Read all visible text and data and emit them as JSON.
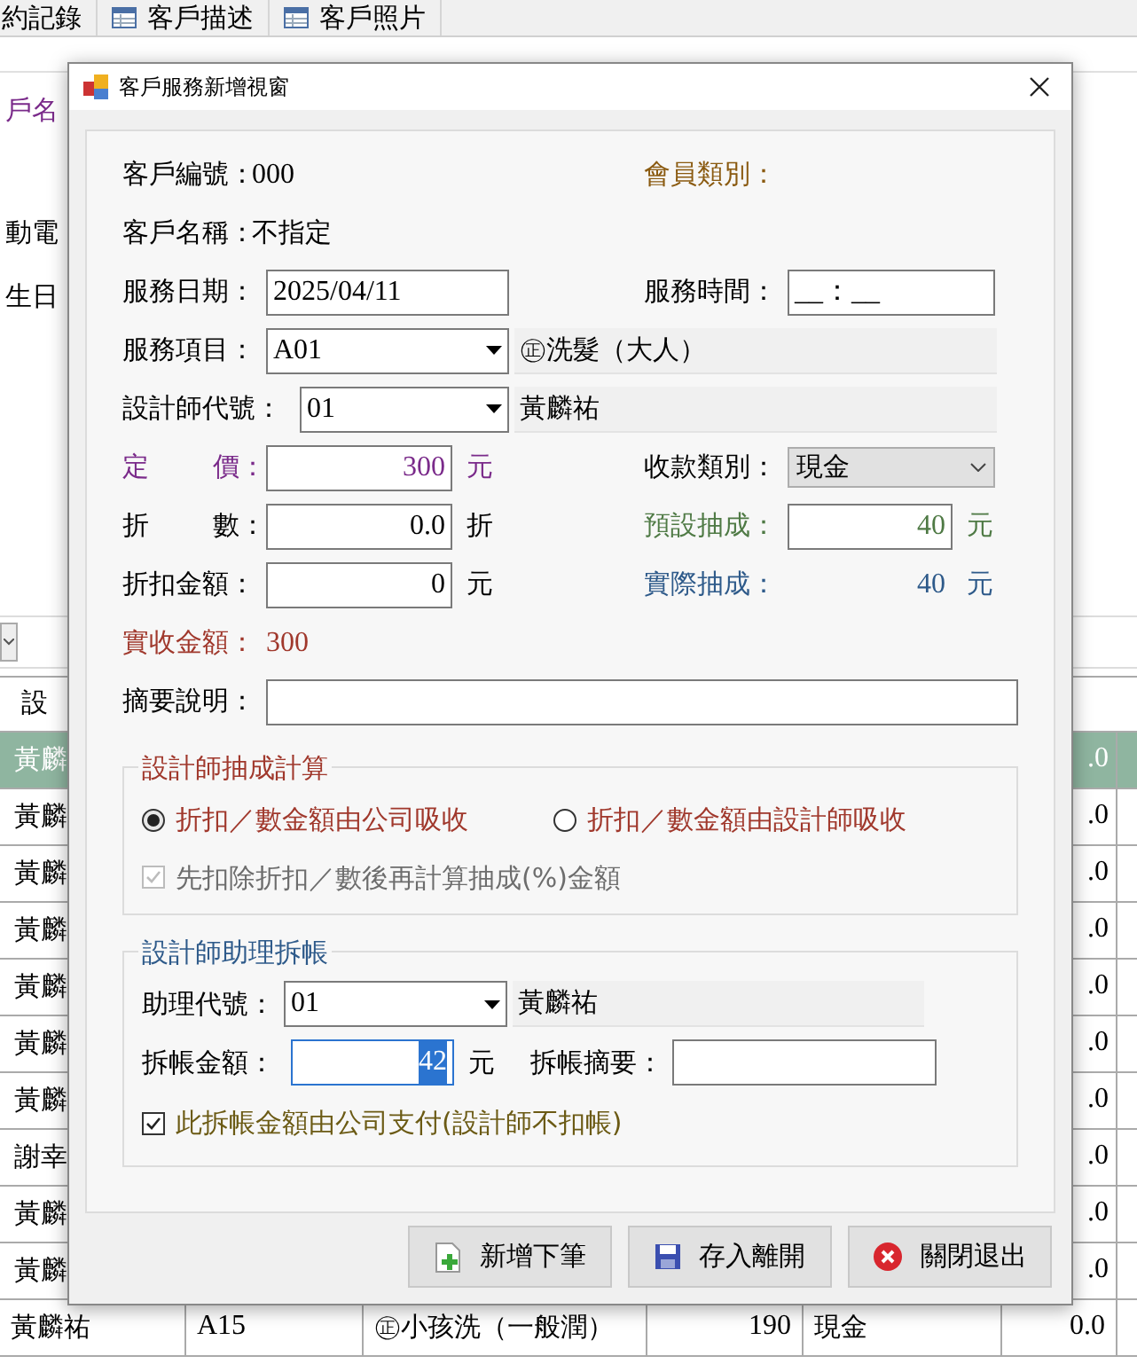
{
  "background": {
    "tabs": [
      {
        "label": "約記錄",
        "icon": false
      },
      {
        "label": "客戶描述",
        "icon": true
      },
      {
        "label": "客戶照片",
        "icon": true
      }
    ],
    "side_labels": [
      "戶名",
      "動電",
      "生日"
    ],
    "table": {
      "header": [
        "設"
      ],
      "rows": [
        {
          "selected": true,
          "cells": [
            "黃麟",
            ".0"
          ]
        },
        {
          "selected": false,
          "cells": [
            "黃麟",
            ".0"
          ]
        },
        {
          "selected": false,
          "cells": [
            "黃麟",
            ".0"
          ]
        },
        {
          "selected": false,
          "cells": [
            "黃麟",
            ".0"
          ]
        },
        {
          "selected": false,
          "cells": [
            "黃麟",
            ".0"
          ]
        },
        {
          "selected": false,
          "cells": [
            "黃麟",
            ".0"
          ]
        },
        {
          "selected": false,
          "cells": [
            "黃麟",
            ".0"
          ]
        },
        {
          "selected": false,
          "cells": [
            "謝幸",
            ".0"
          ]
        },
        {
          "selected": false,
          "cells": [
            "黃麟",
            ".0"
          ]
        },
        {
          "selected": false,
          "cells": [
            "黃麟",
            ".0"
          ]
        },
        {
          "selected": false,
          "cells": [
            "黃麟祐",
            "A15",
            "㊣小孩洗（一般潤）",
            "190",
            "現金",
            "0.0"
          ]
        }
      ]
    }
  },
  "dialog": {
    "title": "客戶服務新增視窗",
    "customer_no": {
      "label": "客戶編號：",
      "value": "000"
    },
    "member_type": {
      "label": "會員類別："
    },
    "customer_name": {
      "label": "客戶名稱：",
      "value": "不指定"
    },
    "service_date": {
      "label": "服務日期：",
      "value": "2025/04/11"
    },
    "service_time": {
      "label": "服務時間：",
      "value": "__：__"
    },
    "service_item": {
      "label": "服務項目：",
      "value": "A01",
      "name": "㊣洗髮（大人）"
    },
    "designer": {
      "label": "設計師代號：",
      "value": "01",
      "name": "黃麟祐"
    },
    "price": {
      "label_left": "定",
      "label_right": "價：",
      "value": "300",
      "unit": "元"
    },
    "payment_type": {
      "label": "收款類別：",
      "value": "現金"
    },
    "discount": {
      "label_left": "折",
      "label_right": "數：",
      "value": "0.0",
      "unit": "折"
    },
    "default_commission": {
      "label": "預設抽成：",
      "value": "40",
      "unit": "元"
    },
    "discount_amount": {
      "label": "折扣金額：",
      "value": "0",
      "unit": "元"
    },
    "actual_commission": {
      "label": "實際抽成：",
      "value": "40",
      "unit": "元"
    },
    "received": {
      "label": "實收金額：",
      "value": "300"
    },
    "memo": {
      "label": "摘要說明："
    },
    "commission_group": {
      "title": "設計師抽成計算",
      "options": [
        {
          "label": "折扣／數金額由公司吸收",
          "selected": true
        },
        {
          "label": "折扣／數金額由設計師吸收",
          "selected": false
        }
      ],
      "checkbox": {
        "label": "先扣除折扣／數後再計算抽成(%)金額",
        "checked": true,
        "disabled": true
      }
    },
    "assistant_group": {
      "title": "設計師助理拆帳",
      "assistant": {
        "label": "助理代號：",
        "value": "01",
        "name": "黃麟祐"
      },
      "split_amount": {
        "label": "拆帳金額：",
        "value": "42",
        "highlighted": true,
        "unit": "元"
      },
      "split_memo": {
        "label": "拆帳摘要："
      },
      "checkbox": {
        "label": "此拆帳金額由公司支付(設計師不扣帳)",
        "checked": true,
        "disabled": false
      }
    },
    "buttons": [
      {
        "kind": "add",
        "label": "新增下筆"
      },
      {
        "kind": "save",
        "label": "存入離開"
      },
      {
        "kind": "close",
        "label": "關閉退出"
      }
    ]
  }
}
